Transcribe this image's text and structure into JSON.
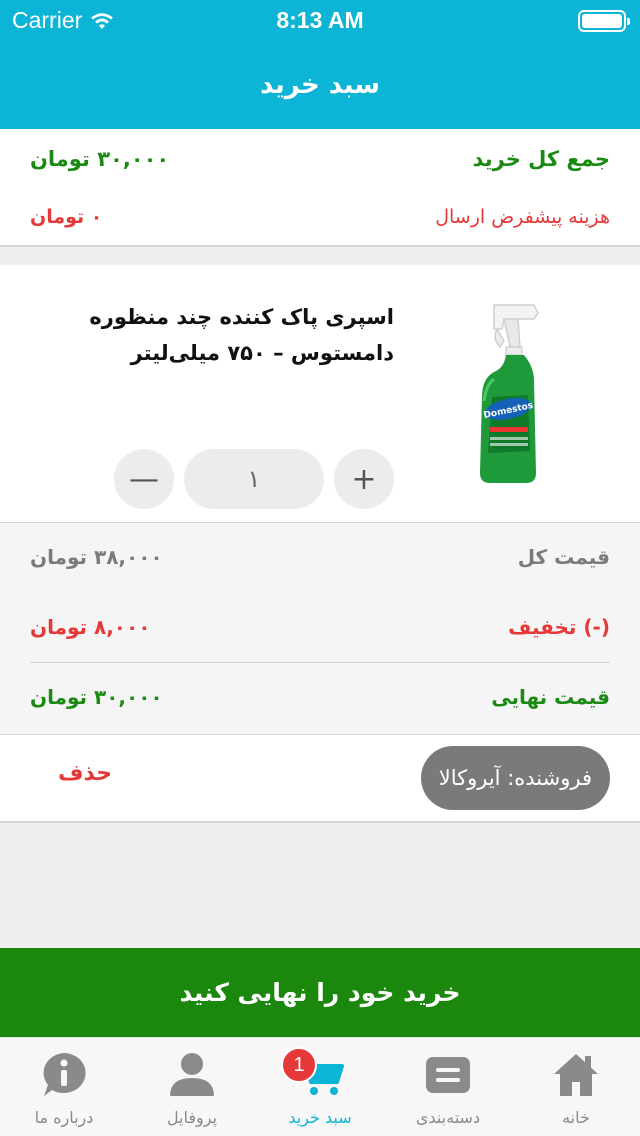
{
  "status_bar": {
    "carrier": "Carrier",
    "time": "8:13 AM"
  },
  "nav": {
    "title": "سبد خرید"
  },
  "summary": {
    "total_label": "جمع کل خرید",
    "total_value": "۳۰,۰۰۰ تومان",
    "shipping_label": "هزینه پیشفرض ارسال",
    "shipping_value": "۰ تومان"
  },
  "product": {
    "title": "اسپری پاک کننده چند منظوره دامستوس – ۷۵۰ میلی‌لیتر",
    "image_icon": "domestos-spray-bottle",
    "quantity": "۱",
    "minus_label": "—",
    "plus_label": "+"
  },
  "prices": {
    "total_label": "قیمت کل",
    "total_value": "۳۸,۰۰۰  تومان",
    "discount_label": "(-) تخفیف",
    "discount_value": "۸,۰۰۰ تومان",
    "final_label": "قیمت نهایی",
    "final_value": "۳۰,۰۰۰  تومان"
  },
  "seller": {
    "label": "فروشنده:  آیروکالا",
    "delete_label": "حذف"
  },
  "checkout": {
    "label": "خرید خود را نهایی کنید"
  },
  "tabs": [
    {
      "label": "خانه",
      "icon": "home-icon"
    },
    {
      "label": "دسته‌بندی",
      "icon": "category-icon"
    },
    {
      "label": "سبد خرید",
      "icon": "cart-icon",
      "badge": "1",
      "active": true
    },
    {
      "label": "پروفایل",
      "icon": "profile-icon"
    },
    {
      "label": "درباره ما",
      "icon": "info-icon"
    }
  ],
  "colors": {
    "primary": "#0cb5d6",
    "green": "#1a8a12",
    "red": "#e53838",
    "checkout": "#1b870d"
  }
}
